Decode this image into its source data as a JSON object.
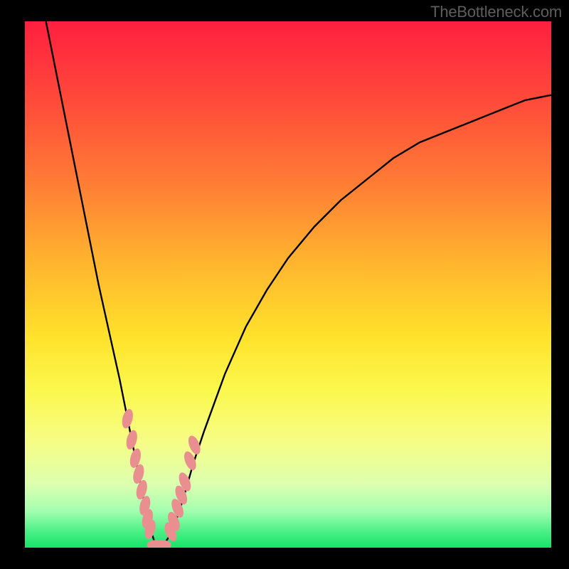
{
  "watermark": "TheBottleneck.com",
  "chart_data": {
    "type": "line",
    "title": "",
    "xlabel": "",
    "ylabel": "",
    "xlim": [
      0,
      100
    ],
    "ylim": [
      0,
      100
    ],
    "grid": false,
    "legend": false,
    "series": [
      {
        "name": "bottleneck-curve",
        "x": [
          4,
          6,
          8,
          10,
          12,
          14,
          16,
          18,
          20,
          21,
          22,
          23,
          24,
          25,
          26,
          28,
          30,
          32,
          34,
          38,
          42,
          46,
          50,
          55,
          60,
          65,
          70,
          75,
          80,
          85,
          90,
          95,
          100
        ],
        "y": [
          100,
          90,
          80,
          70,
          60,
          50,
          41,
          32,
          22,
          17,
          12,
          7,
          3,
          0,
          0,
          3,
          9,
          16,
          22,
          33,
          42,
          49,
          55,
          61,
          66,
          70,
          74,
          77,
          79,
          81,
          83,
          85,
          86
        ]
      },
      {
        "name": "highlight-markers-left",
        "x": [
          19.5,
          20.3,
          21.0,
          21.6,
          22.2,
          22.8,
          23.3,
          23.8
        ],
        "y": [
          24.5,
          20.5,
          17.0,
          14.0,
          11.0,
          8.0,
          5.5,
          3.5
        ]
      },
      {
        "name": "highlight-markers-bottom",
        "x": [
          24.8,
          25.4,
          26.2
        ],
        "y": [
          0.5,
          0.3,
          0.5
        ]
      },
      {
        "name": "highlight-markers-right",
        "x": [
          27.7,
          28.3,
          29.0,
          29.7,
          30.4,
          31.4,
          32.2
        ],
        "y": [
          3.0,
          5.0,
          7.5,
          10.0,
          12.5,
          16.5,
          19.5
        ]
      }
    ],
    "gradient_background": {
      "stops": [
        {
          "pos": 0,
          "color": "#ff1f3f"
        },
        {
          "pos": 15,
          "color": "#ff4a3a"
        },
        {
          "pos": 30,
          "color": "#ff7a35"
        },
        {
          "pos": 45,
          "color": "#ffb22e"
        },
        {
          "pos": 60,
          "color": "#ffe22b"
        },
        {
          "pos": 70,
          "color": "#fbf84d"
        },
        {
          "pos": 80,
          "color": "#f6fd86"
        },
        {
          "pos": 88,
          "color": "#dcffb0"
        },
        {
          "pos": 93,
          "color": "#a4ffb0"
        },
        {
          "pos": 97,
          "color": "#49ef85"
        },
        {
          "pos": 100,
          "color": "#17e36a"
        }
      ]
    },
    "colors": {
      "curve": "#000000",
      "marker_fill": "#e98f8f",
      "frame": "#000000"
    }
  }
}
